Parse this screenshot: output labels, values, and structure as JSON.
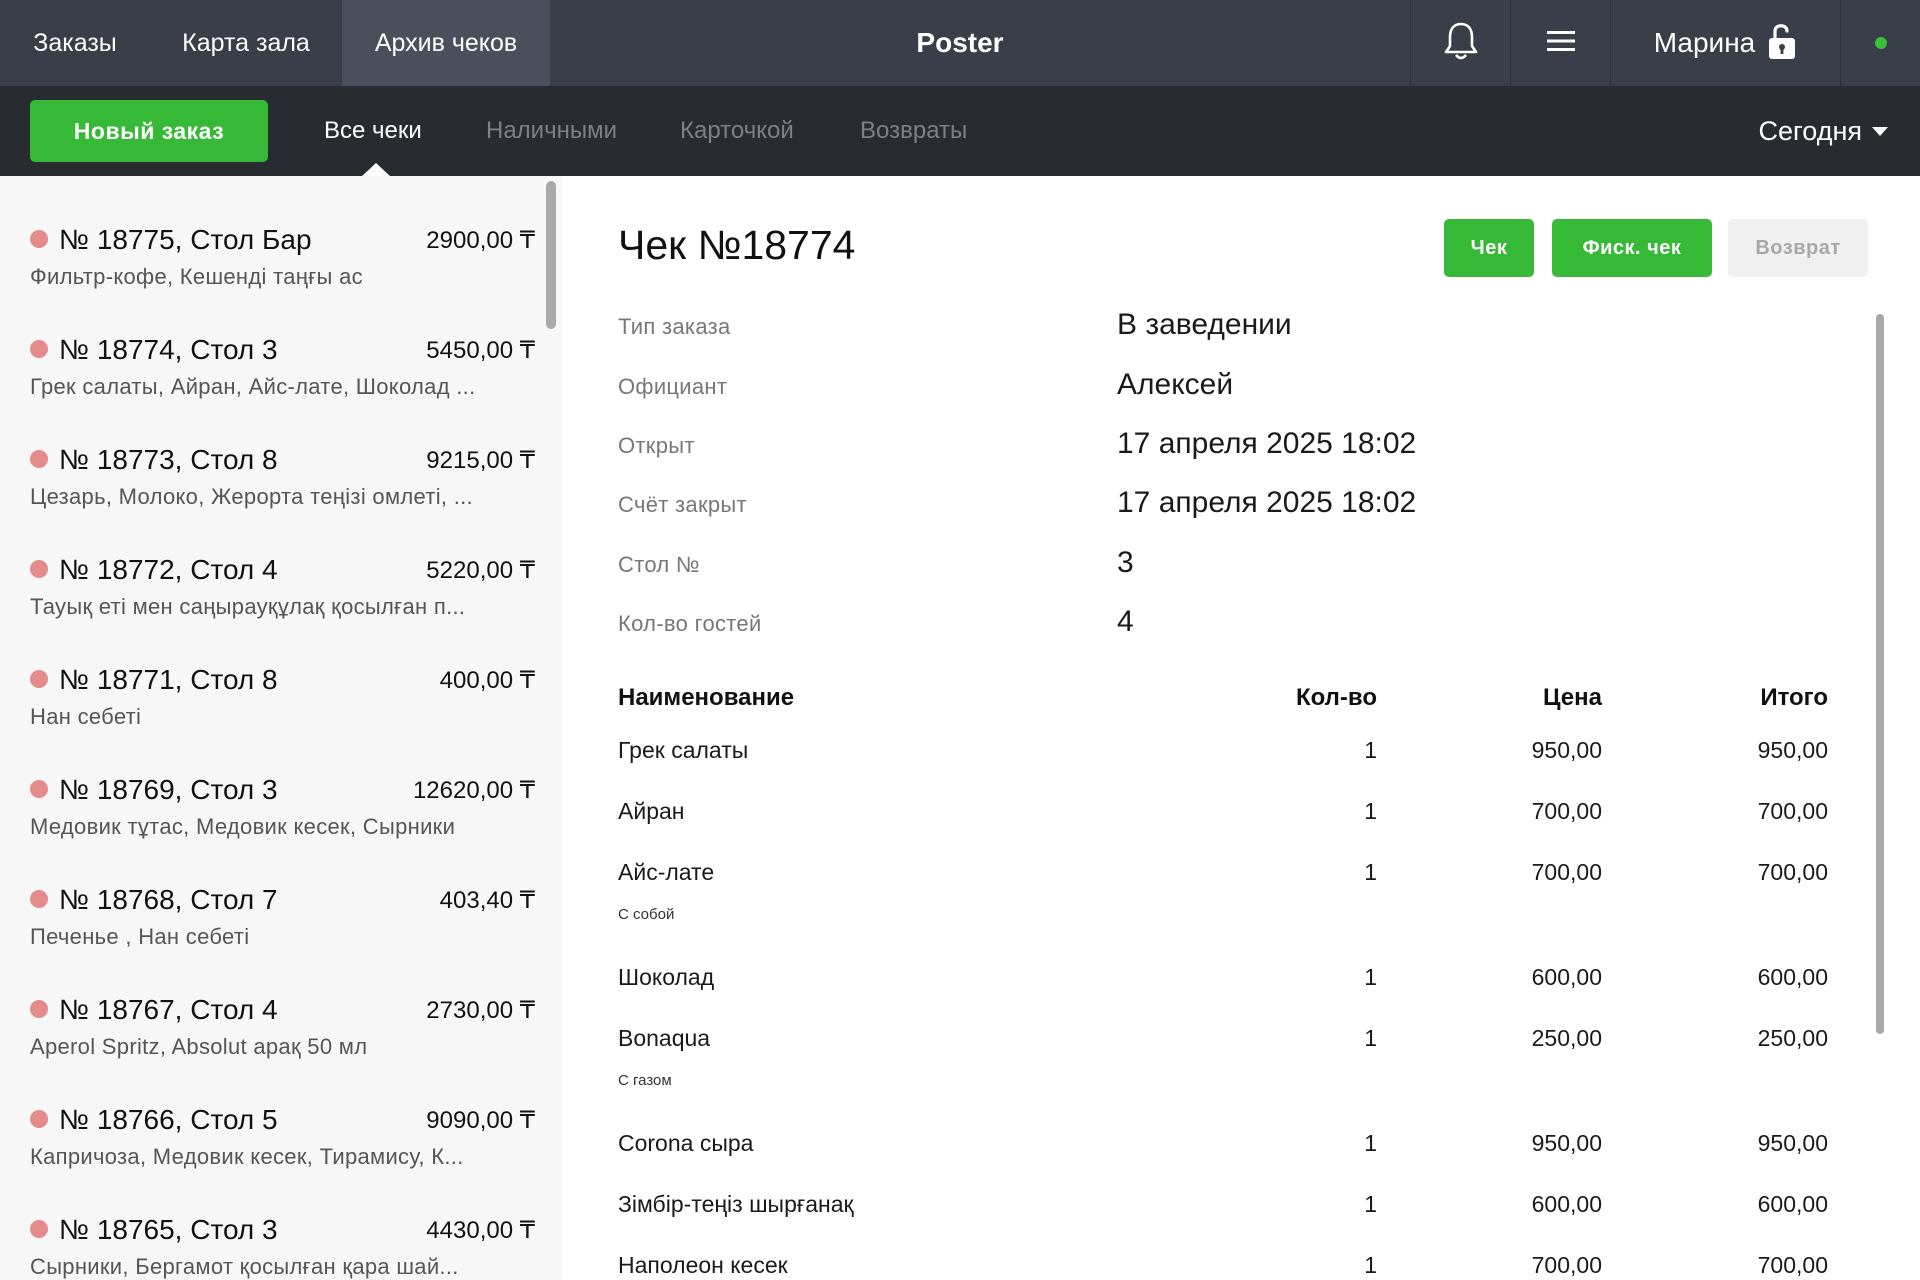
{
  "top": {
    "tabs": [
      "Заказы",
      "Карта зала",
      "Архив чеков"
    ],
    "active_tab": 2,
    "app_title": "Poster",
    "user": "Марина"
  },
  "sub": {
    "new_order": "Новый заказ",
    "filters": [
      "Все чеки",
      "Наличными",
      "Карточкой",
      "Возвраты"
    ],
    "active_filter": 0,
    "period": "Сегодня"
  },
  "receipts": [
    {
      "title": "№ 18775, Стол Бар",
      "sum": "2900,00 ₸",
      "items": "Фильтр-кофе, Кешенді таңғы ас"
    },
    {
      "title": "№ 18774, Стол 3",
      "sum": "5450,00 ₸",
      "items": "Грек салаты, Айран, Айс-лате, Шоколад ..."
    },
    {
      "title": "№ 18773, Стол 8",
      "sum": "9215,00 ₸",
      "items": "Цезарь, Молоко, Жерорта теңізі омлеті, ..."
    },
    {
      "title": "№ 18772, Стол 4",
      "sum": "5220,00 ₸",
      "items": "Тауық еті мен саңырауқұлақ қосылған п..."
    },
    {
      "title": "№ 18771, Стол 8",
      "sum": "400,00 ₸",
      "items": "Нан себеті"
    },
    {
      "title": "№ 18769, Стол 3",
      "sum": "12620,00 ₸",
      "items": "Медовик тұтас, Медовик кесек, Сырники"
    },
    {
      "title": "№ 18768, Стол 7",
      "sum": "403,40 ₸",
      "items": "Печенье , Нан себеті"
    },
    {
      "title": "№ 18767, Стол 4",
      "sum": "2730,00 ₸",
      "items": "Aperol Spritz, Absolut арақ 50 мл"
    },
    {
      "title": "№ 18766, Стол 5",
      "sum": "9090,00 ₸",
      "items": "Капричоза, Медовик кесек, Тирамису, К..."
    },
    {
      "title": "№ 18765, Стол 3",
      "sum": "4430,00 ₸",
      "items": "Сырники, Бергамот қосылған қара шай..."
    }
  ],
  "detail": {
    "title": "Чек №18774",
    "btn_check": "Чек",
    "btn_fisc": "Фиск. чек",
    "btn_return": "Возврат",
    "info": [
      {
        "label": "Тип заказа",
        "value": "В заведении"
      },
      {
        "label": "Официант",
        "value": "Алексей"
      },
      {
        "label": "Открыт",
        "value": "17 апреля 2025 18:02"
      },
      {
        "label": "Счёт закрыт",
        "value": "17 апреля 2025 18:02"
      },
      {
        "label": "Стол №",
        "value": "3"
      },
      {
        "label": "Кол-во гостей",
        "value": "4"
      }
    ],
    "columns": {
      "name": "Наименование",
      "qty": "Кол-во",
      "price": "Цена",
      "total": "Итого"
    },
    "rows": [
      {
        "name": "Грек салаты",
        "mod": "",
        "qty": "1",
        "price": "950,00",
        "total": "950,00"
      },
      {
        "name": "Айран",
        "mod": "",
        "qty": "1",
        "price": "700,00",
        "total": "700,00"
      },
      {
        "name": "Айс-лате",
        "mod": "С собой",
        "qty": "1",
        "price": "700,00",
        "total": "700,00"
      },
      {
        "name": "Шоколад",
        "mod": "",
        "qty": "1",
        "price": "600,00",
        "total": "600,00"
      },
      {
        "name": "Bonaqua",
        "mod": "С газом",
        "qty": "1",
        "price": "250,00",
        "total": "250,00"
      },
      {
        "name": "Corona сыра",
        "mod": "",
        "qty": "1",
        "price": "950,00",
        "total": "950,00"
      },
      {
        "name": "Зімбір-теңіз шырғанақ",
        "mod": "",
        "qty": "1",
        "price": "600,00",
        "total": "600,00"
      },
      {
        "name": "Наполеон кесек",
        "mod": "",
        "qty": "1",
        "price": "700,00",
        "total": "700,00"
      }
    ]
  },
  "colors": {
    "accent_green": "#36b936",
    "topbar": "#393e48",
    "subbar": "#282b30",
    "dot": "#e48c8c"
  }
}
